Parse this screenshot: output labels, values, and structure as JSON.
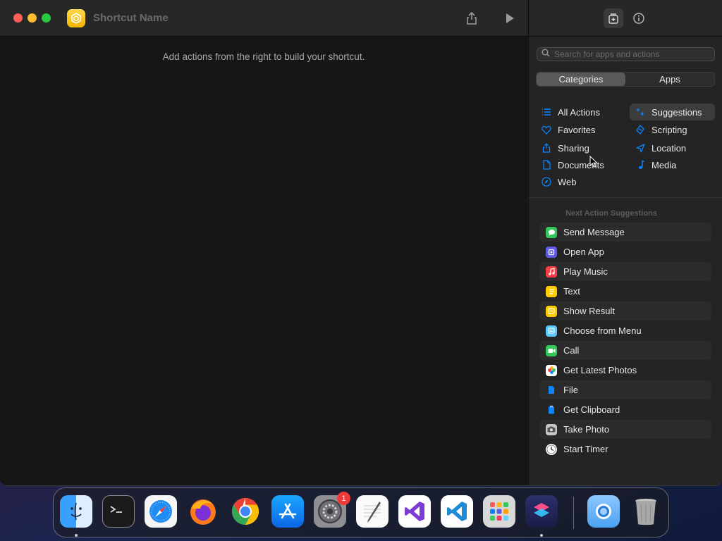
{
  "window": {
    "title": "Shortcut Name",
    "empty_hint": "Add actions from the right to build your shortcut."
  },
  "sidebar": {
    "search_placeholder": "Search for apps and actions",
    "tabs": [
      {
        "label": "Categories",
        "active": true
      },
      {
        "label": "Apps",
        "active": false
      }
    ],
    "categories_left": [
      {
        "label": "All Actions",
        "icon": "list-icon"
      },
      {
        "label": "Favorites",
        "icon": "heart-icon"
      },
      {
        "label": "Sharing",
        "icon": "share-icon"
      },
      {
        "label": "Documents",
        "icon": "document-icon"
      },
      {
        "label": "Web",
        "icon": "compass-icon"
      }
    ],
    "categories_right": [
      {
        "label": "Suggestions",
        "icon": "sparkle-icon",
        "selected": true
      },
      {
        "label": "Scripting",
        "icon": "scripting-icon"
      },
      {
        "label": "Location",
        "icon": "location-arrow-icon"
      },
      {
        "label": "Media",
        "icon": "music-note-icon"
      }
    ],
    "suggestions_title": "Next Action Suggestions",
    "suggestions": [
      {
        "label": "Send Message",
        "icon": "messages-icon",
        "color": "#34c759"
      },
      {
        "label": "Open App",
        "icon": "open-app-icon",
        "color": "#5e5ce6"
      },
      {
        "label": "Play Music",
        "icon": "music-icon",
        "color": "#fc3c44"
      },
      {
        "label": "Text",
        "icon": "text-icon",
        "color": "#ffcc00"
      },
      {
        "label": "Show Result",
        "icon": "show-result-icon",
        "color": "#ffcc00"
      },
      {
        "label": "Choose from Menu",
        "icon": "menu-icon",
        "color": "#5ac8fa"
      },
      {
        "label": "Call",
        "icon": "facetime-icon",
        "color": "#34c759"
      },
      {
        "label": "Get Latest Photos",
        "icon": "photos-icon",
        "color": "#ffffff"
      },
      {
        "label": "File",
        "icon": "file-icon",
        "color": "#0a84ff"
      },
      {
        "label": "Get Clipboard",
        "icon": "clipboard-icon",
        "color": "#0a84ff"
      },
      {
        "label": "Take Photo",
        "icon": "camera-icon",
        "color": "#8e8e93"
      },
      {
        "label": "Start Timer",
        "icon": "clock-icon",
        "color": "#ffffff"
      }
    ]
  },
  "dock": {
    "items": [
      {
        "name": "finder-icon",
        "running": true
      },
      {
        "name": "terminal-icon",
        "running": false
      },
      {
        "name": "safari-icon",
        "running": false
      },
      {
        "name": "firefox-icon",
        "running": false
      },
      {
        "name": "chrome-icon",
        "running": false
      },
      {
        "name": "app-store-icon",
        "running": false
      },
      {
        "name": "system-settings-icon",
        "running": false,
        "badge": "1"
      },
      {
        "name": "textedit-icon",
        "running": false
      },
      {
        "name": "visual-studio-icon",
        "running": false
      },
      {
        "name": "vscode-icon",
        "running": false
      },
      {
        "name": "launchpad-icon",
        "running": false
      },
      {
        "name": "shortcuts-icon",
        "running": true
      },
      {
        "name": "downloads-folder-icon",
        "running": false
      },
      {
        "name": "trash-icon",
        "running": false
      }
    ]
  },
  "colors": {
    "accent": "#0a84ff",
    "close": "#fe5f57",
    "minimize": "#febc2e",
    "maximize": "#28c840"
  }
}
